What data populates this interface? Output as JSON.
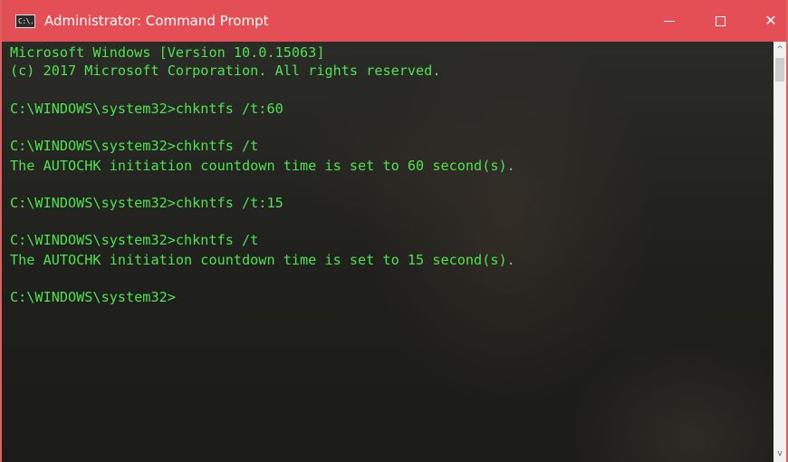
{
  "window": {
    "title": "Administrator: Command Prompt",
    "icon_text": "C:\\.",
    "minimize_icon": "minimize-icon",
    "maximize_icon": "maximize-icon",
    "close_icon": "close-icon",
    "close_glyph": "✕",
    "titlebar_color": "#e44f55"
  },
  "console": {
    "text_color": "#4ee34e",
    "lines": [
      "Microsoft Windows [Version 10.0.15063]",
      "(c) 2017 Microsoft Corporation. All rights reserved.",
      "",
      "C:\\WINDOWS\\system32>chkntfs /t:60",
      "",
      "C:\\WINDOWS\\system32>chkntfs /t",
      "The AUTOCHK initiation countdown time is set to 60 second(s).",
      "",
      "C:\\WINDOWS\\system32>chkntfs /t:15",
      "",
      "C:\\WINDOWS\\system32>chkntfs /t",
      "The AUTOCHK initiation countdown time is set to 15 second(s).",
      "",
      "C:\\WINDOWS\\system32>"
    ]
  },
  "scrollbar": {
    "up_glyph": "^",
    "down_glyph": "v"
  }
}
